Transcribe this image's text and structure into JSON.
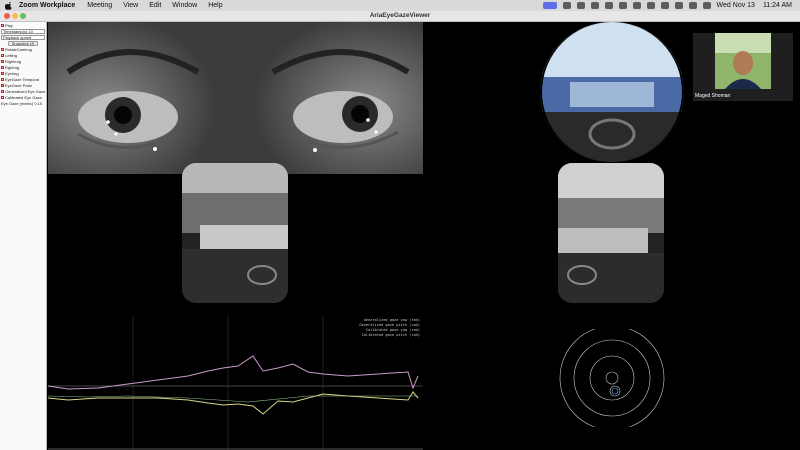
{
  "menubar": {
    "app_name": "Zoom Workplace",
    "menus": [
      "Meeting",
      "View",
      "Edit",
      "Window",
      "Help"
    ],
    "date": "Wed Nov 13",
    "time": "11:24 AM",
    "icons": [
      "apple-icon",
      "zoom-share-icon",
      "battery-icon",
      "wifi-icon",
      "search-icon",
      "control-center-icon"
    ]
  },
  "window": {
    "title": "AriaEyeGazeViewer"
  },
  "sidebar": {
    "items": [
      {
        "label": "Play",
        "checked": true
      },
      {
        "label": "Timestamp(s) 10",
        "checked": true
      },
      {
        "label": "Playback speed",
        "checked": true
      },
      {
        "label": "Snapshot 10",
        "checked": false
      },
      {
        "label": "RotateCamImg",
        "checked": true
      },
      {
        "label": "Lefting",
        "checked": true
      },
      {
        "label": "RightImg",
        "checked": true
      },
      {
        "label": "RgbImg",
        "checked": true
      },
      {
        "label": "EyeImg",
        "checked": true
      },
      {
        "label": "EyeGaze Temporal",
        "checked": true
      },
      {
        "label": "EyeGaze Polar",
        "checked": true
      },
      {
        "label": "Generalized Eye Gaze",
        "checked": true
      },
      {
        "label": "Calibrated Eye Gaze",
        "checked": true
      },
      {
        "label": "Eye Gaze (metric) 0.10",
        "checked": false
      }
    ]
  },
  "zoom": {
    "participant_name": "Maged Shoman"
  },
  "legend": {
    "lines": [
      "Generalized gaze yaw (rad)",
      "Generalized gaze pitch (rad)",
      "Calibrated gaze yaw (rad)",
      "Calibrated gaze pitch (rad)"
    ]
  },
  "colors": {
    "menubar": "#d9d9db",
    "titlebar": "#e6e6e6",
    "close": "#ee5b54",
    "minimize": "#f4bd4f",
    "maximize": "#61c454",
    "series_yaw": "#c89cc8",
    "series_pitch": "#d6d68a",
    "series_cal_yaw": "#8fbf8f",
    "series_cal_pitch": "#e0a070"
  }
}
